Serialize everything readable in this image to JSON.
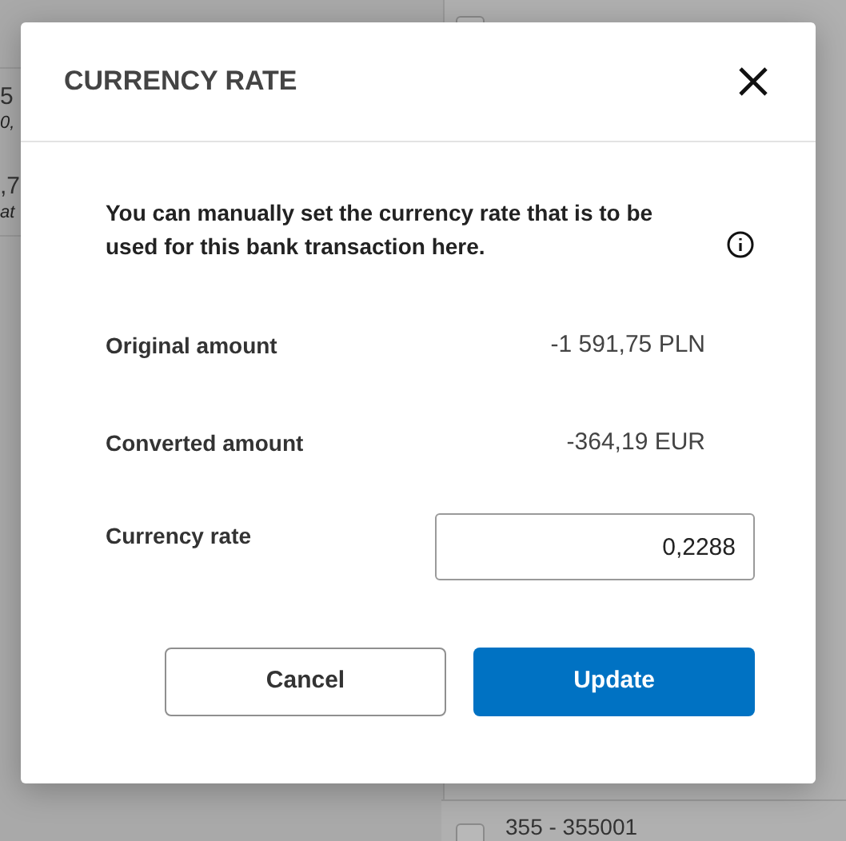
{
  "background": {
    "left_texts": [
      "5",
      "0,",
      ",7",
      "at"
    ],
    "checkboxes": [
      {
        "checked": false
      },
      {
        "checked": false
      }
    ],
    "row_label": "355 - 355001"
  },
  "dialog": {
    "title": "CURRENCY RATE",
    "description": "You can manually set the currency rate that is to be used for this bank transaction here.",
    "fields": [
      {
        "kind": "text",
        "label": "Original amount",
        "value": "-1 591,75 PLN"
      },
      {
        "kind": "text",
        "label": "Converted amount",
        "value": "-364,19 EUR"
      },
      {
        "kind": "input",
        "label": "Currency rate",
        "value": "0,2288"
      }
    ],
    "buttons": [
      {
        "kind": "secondary",
        "label": "Cancel"
      },
      {
        "kind": "primary",
        "label": "Update"
      }
    ]
  }
}
